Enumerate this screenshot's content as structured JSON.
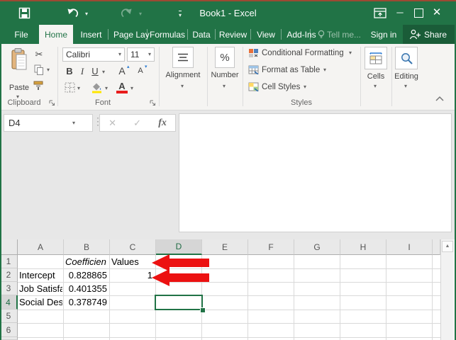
{
  "colors": {
    "titlebar": "#217346",
    "accent": "#217346",
    "share_bg": "#1a5c38",
    "ribbon_bg": "#f5f4f2",
    "arrow": "#ec1111",
    "top_edge": "#9b4a33"
  },
  "titlebar": {
    "title": "Book1 - Excel"
  },
  "tabs": {
    "items": [
      "File",
      "Home",
      "Insert",
      "Page Layo",
      "Formulas",
      "Data",
      "Review",
      "View",
      "Add-Ins"
    ],
    "active": "Home",
    "tell_me": "Tell me...",
    "sign_in": "Sign in",
    "share": "Share"
  },
  "ribbon": {
    "clipboard": {
      "label": "Clipboard",
      "paste": "Paste"
    },
    "font": {
      "label": "Font",
      "family": "Calibri",
      "size": "11",
      "bold": "B",
      "italic": "I",
      "underline": "U",
      "grow": "A",
      "shrink": "A",
      "color_letter": "A"
    },
    "alignment": {
      "label": "Alignment"
    },
    "number": {
      "label": "Number",
      "percent": "%"
    },
    "styles": {
      "label": "Styles",
      "conditional_formatting": "Conditional Formatting",
      "format_as_table": "Format as Table",
      "cell_styles": "Cell Styles"
    },
    "cells": {
      "label": "Cells"
    },
    "editing": {
      "label": "Editing"
    }
  },
  "formula_bar": {
    "name_box": "D4",
    "fx": "fx"
  },
  "sheet": {
    "col_headers": [
      "A",
      "B",
      "C",
      "D",
      "E",
      "F",
      "G",
      "H",
      "I"
    ],
    "row_headers": [
      "1",
      "2",
      "3",
      "4",
      "5",
      "6"
    ],
    "active_col": "D",
    "active_row": "4",
    "selected_cell": "D4",
    "cells": {
      "B1": "Coefficien",
      "C1": "Values",
      "A2": "Intercept",
      "B2": "0.828865",
      "C2": "1",
      "A3": "Job Satisfa",
      "B3": "0.401355",
      "A4": "Social Des",
      "B4": "0.378749"
    }
  },
  "icons": {
    "caret": "▾",
    "cut": "✂",
    "dots": "⋮",
    "cancel": "✕",
    "enter": "✓",
    "close": "✕",
    "minimize": "─",
    "scroll_up": "▲"
  }
}
